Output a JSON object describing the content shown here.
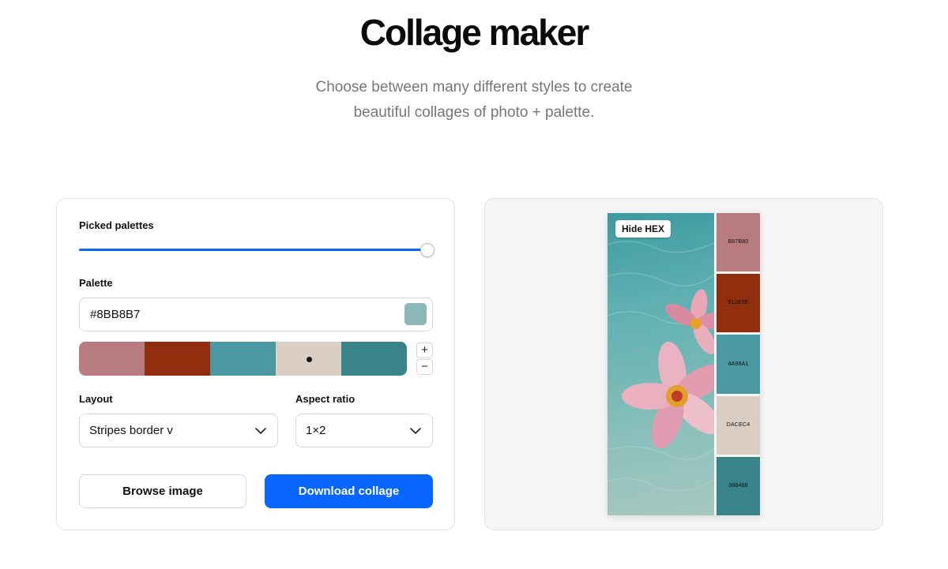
{
  "header": {
    "title": "Collage maker",
    "subtitle_line1": "Choose between many different styles to create",
    "subtitle_line2": "beautiful collages of photo + palette."
  },
  "controls": {
    "picked_palettes_label": "Picked palettes",
    "picked_palettes_value": 1.0,
    "palette_label": "Palette",
    "hex_value": "#8BB8B7",
    "hex_swatch_color": "#8BB8B7",
    "palette": [
      "#B87B80",
      "#912E0E",
      "#4A98A1",
      "#DACEC4",
      "#388488"
    ],
    "selected_index": 3,
    "add_label": "+",
    "remove_label": "−",
    "layout_label": "Layout",
    "layout_value": "Stripes border v",
    "aspect_label": "Aspect ratio",
    "aspect_value": "1×2",
    "browse_label": "Browse image",
    "download_label": "Download collage",
    "accent_color": "#0866FF"
  },
  "preview": {
    "hide_hex_label": "Hide HEX",
    "stripes": [
      {
        "color": "#B87B80",
        "hex": "B87B80"
      },
      {
        "color": "#912E0E",
        "hex": "912E0E"
      },
      {
        "color": "#4A98A1",
        "hex": "4A98A1"
      },
      {
        "color": "#DACEC4",
        "hex": "DACEC4"
      },
      {
        "color": "#388488",
        "hex": "388488"
      }
    ]
  }
}
